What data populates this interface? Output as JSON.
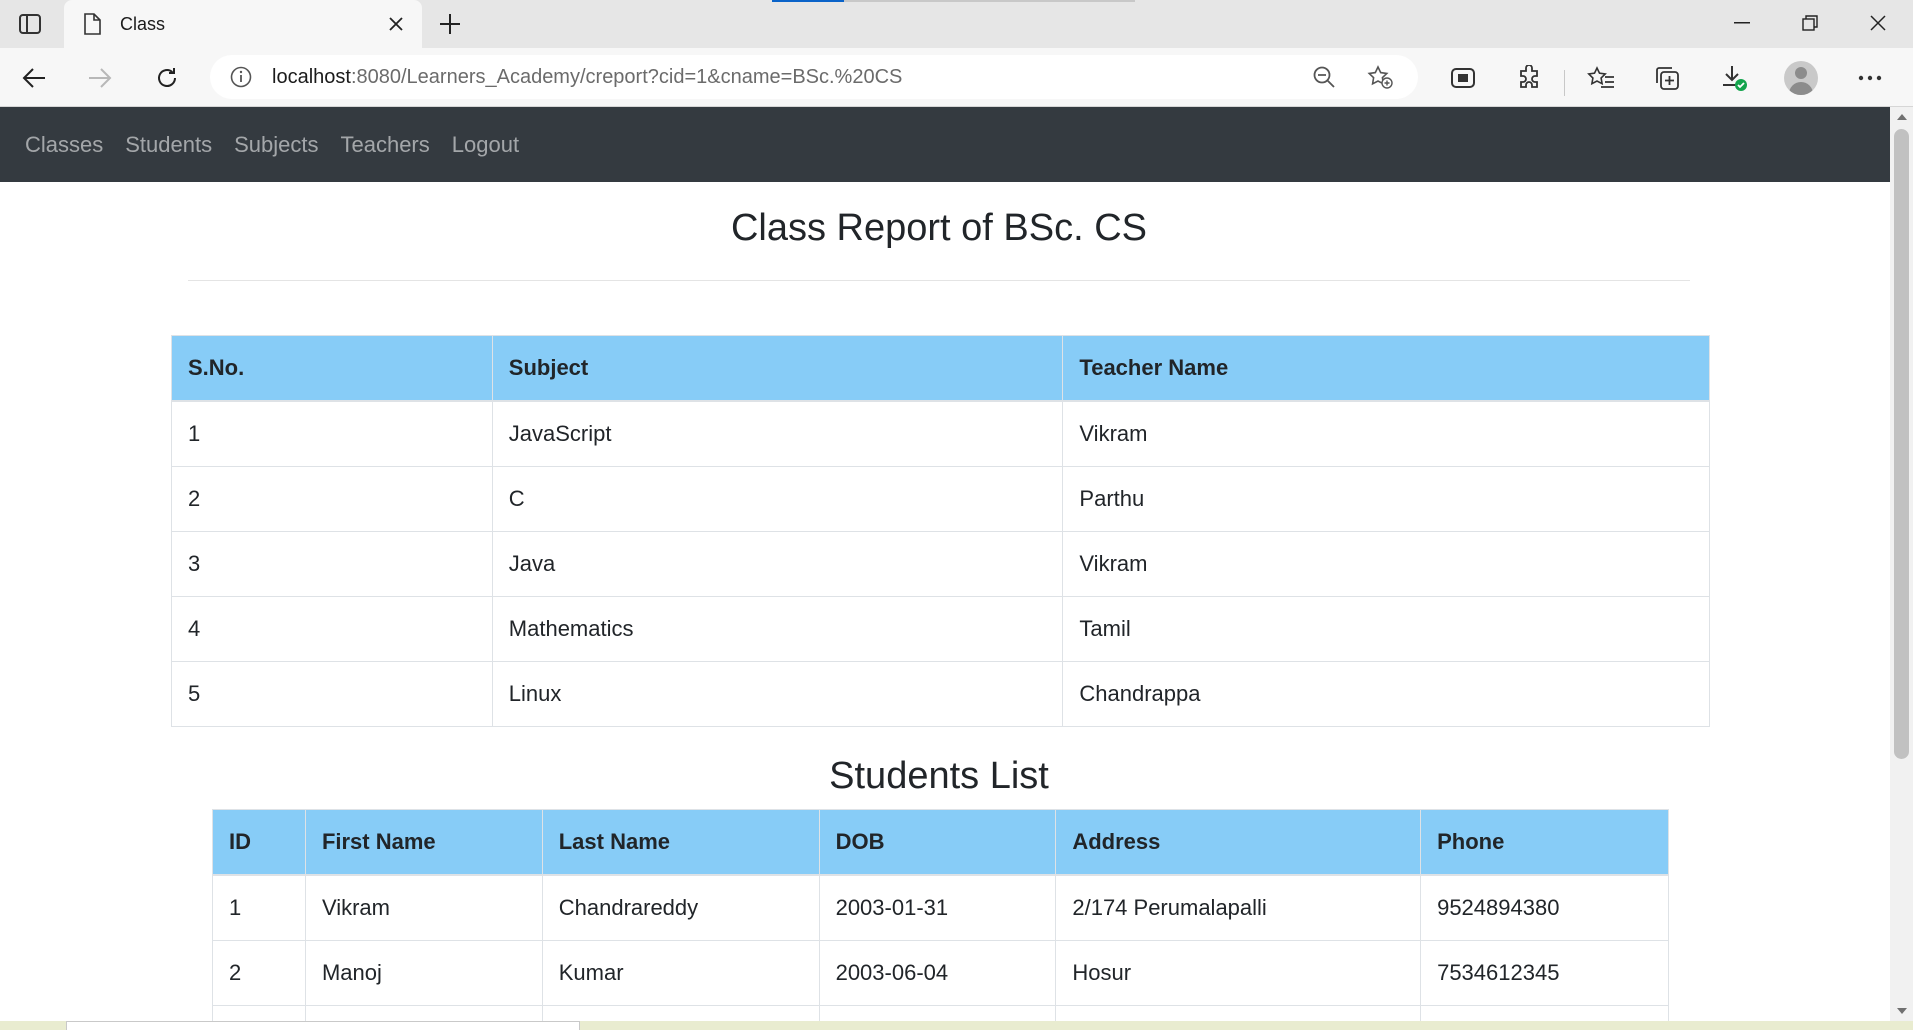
{
  "browser": {
    "tab_title": "Class",
    "url_host": "localhost",
    "url_rest": ":8080/Learners_Academy/creport?cid=1&cname=BSc.%20CS"
  },
  "nav": {
    "links": [
      "Classes",
      "Students",
      "Subjects",
      "Teachers",
      "Logout"
    ]
  },
  "report": {
    "title": "Class Report of BSc. CS",
    "subjects_headers": [
      "S.No.",
      "Subject",
      "Teacher Name"
    ],
    "subjects_rows": [
      [
        "1",
        "JavaScript",
        "Vikram"
      ],
      [
        "2",
        "C",
        "Parthu"
      ],
      [
        "3",
        "Java",
        "Vikram"
      ],
      [
        "4",
        "Mathematics",
        "Tamil"
      ],
      [
        "5",
        "Linux",
        "Chandrappa"
      ]
    ]
  },
  "students": {
    "title": "Students List",
    "headers": [
      "ID",
      "First Name",
      "Last Name",
      "DOB",
      "Address",
      "Phone"
    ],
    "rows": [
      [
        "1",
        "Vikram",
        "Chandrareddy",
        "2003-01-31",
        "2/174 Perumalapalli",
        "9524894380"
      ],
      [
        "2",
        "Manoj",
        "Kumar",
        "2003-06-04",
        "Hosur",
        "7534612345"
      ]
    ]
  },
  "colors": {
    "navbar_bg": "#343a40",
    "table_header_bg": "#87ccf7"
  },
  "icons": [
    "tab-actions-icon",
    "page-icon",
    "close-icon",
    "plus-icon",
    "minimize-icon",
    "restore-icon",
    "back-arrow-icon",
    "forward-arrow-icon",
    "refresh-icon",
    "info-icon",
    "zoom-out-icon",
    "add-favorite-icon",
    "browser-essentials-icon",
    "extensions-icon",
    "favorites-icon",
    "collections-icon",
    "downloads-icon",
    "profile-avatar-icon",
    "more-icon"
  ]
}
